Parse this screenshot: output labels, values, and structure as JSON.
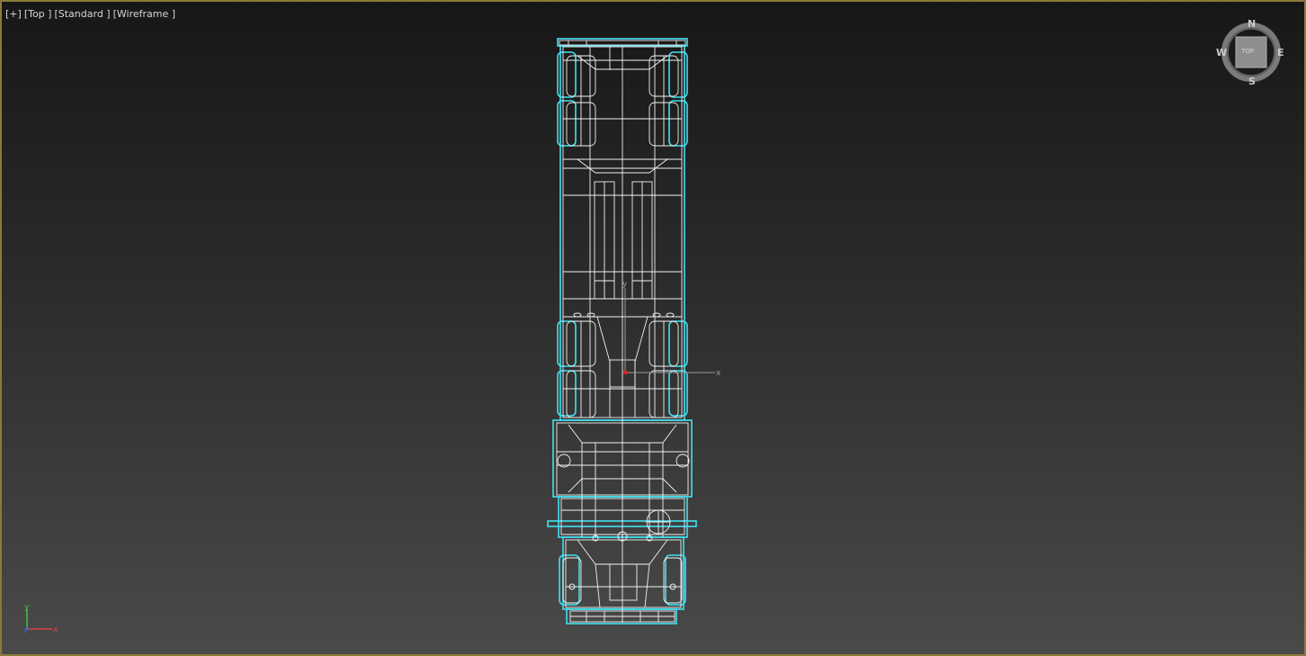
{
  "viewport": {
    "label_plus": "[+]",
    "label_view": "[Top ]",
    "label_shading_1": "[Standard ]",
    "label_shading_2": "[Wireframe ]"
  },
  "viewcube": {
    "north": "N",
    "south": "S",
    "east": "E",
    "west": "W",
    "face": "TOP"
  },
  "gizmo": {
    "x_label": "x",
    "y_label": "y"
  },
  "tripod": {
    "x_label": "x",
    "y_label": "y",
    "z_label": "z"
  },
  "colors": {
    "viewport_border": "#8a7a3a",
    "selection_wire": "#41e0f0",
    "wire": "#ffffff",
    "axis_x": "#e04040",
    "axis_y": "#40c040",
    "axis_z": "#4060e0"
  }
}
